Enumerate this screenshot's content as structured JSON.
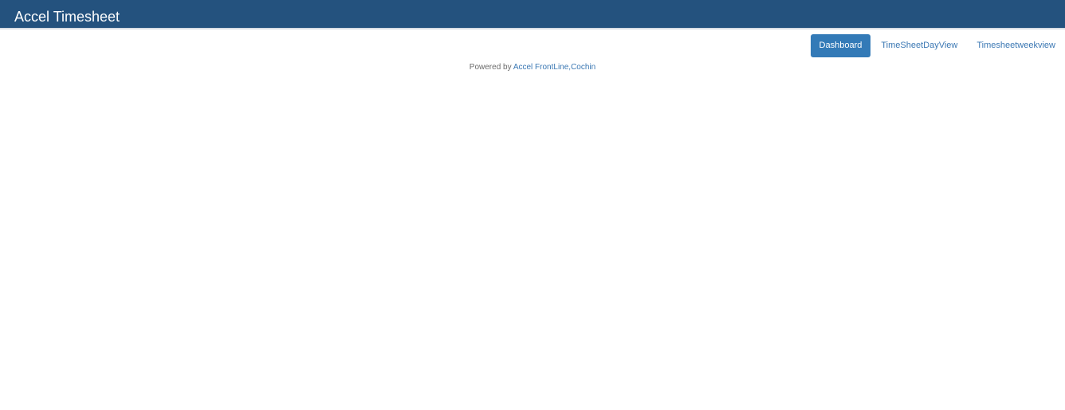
{
  "header": {
    "title": "Accel Timesheet"
  },
  "nav": {
    "items": [
      {
        "label": "Dashboard",
        "active": true
      },
      {
        "label": "TimeSheetDayView",
        "active": false
      },
      {
        "label": "Timesheetweekview",
        "active": false
      }
    ]
  },
  "footer": {
    "prefix": "Powered by",
    "link_label": "Accel FrontLine,Cochin"
  },
  "colors": {
    "header_bg": "#24527e",
    "accent": "#337ab7",
    "link": "#3a77b3"
  }
}
